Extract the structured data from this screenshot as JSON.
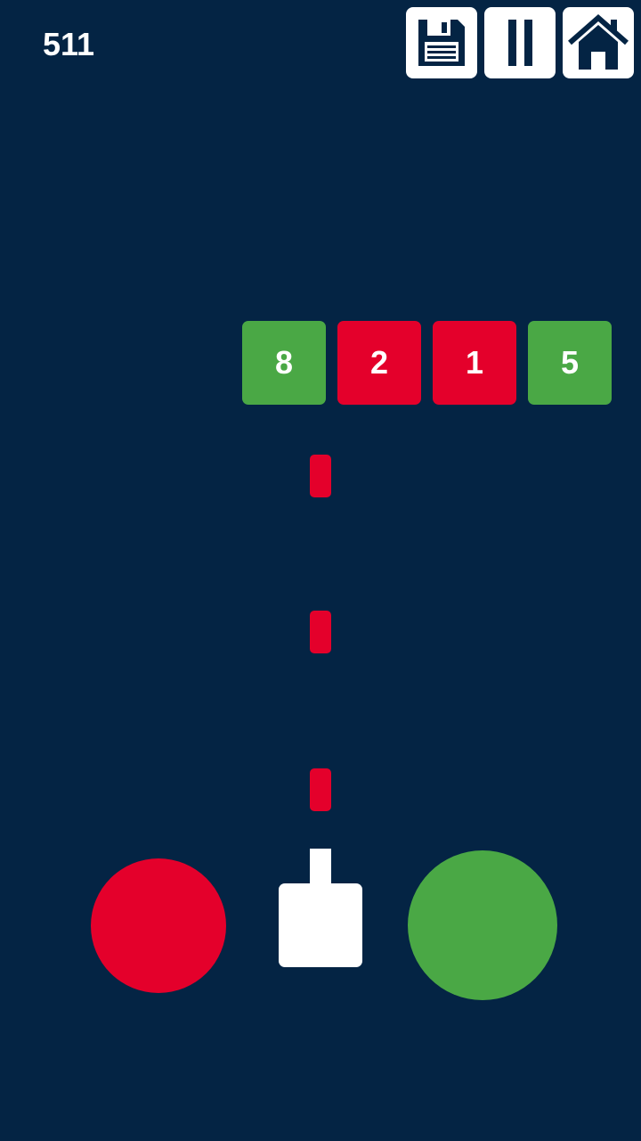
{
  "hud": {
    "score": "511",
    "buttons": [
      {
        "name": "save-button",
        "icon": "floppy-disk-icon"
      },
      {
        "name": "pause-button",
        "icon": "pause-icon"
      },
      {
        "name": "home-button",
        "icon": "home-icon"
      }
    ]
  },
  "colors": {
    "background": "#042444",
    "red": "#E4002B",
    "green": "#4AA845",
    "white": "#FFFFFF",
    "icon": "#042444"
  },
  "blocks": [
    {
      "value": "8",
      "color": "green"
    },
    {
      "value": "2",
      "color": "red"
    },
    {
      "value": "1",
      "color": "red"
    },
    {
      "value": "5",
      "color": "green"
    }
  ],
  "bullets": [
    {
      "color": "red"
    },
    {
      "color": "red"
    },
    {
      "color": "red"
    }
  ],
  "color_selectors": [
    {
      "color": "red",
      "name": "red-ball-button"
    },
    {
      "color": "green",
      "name": "green-ball-button"
    }
  ],
  "cannon": {
    "color": "white"
  }
}
